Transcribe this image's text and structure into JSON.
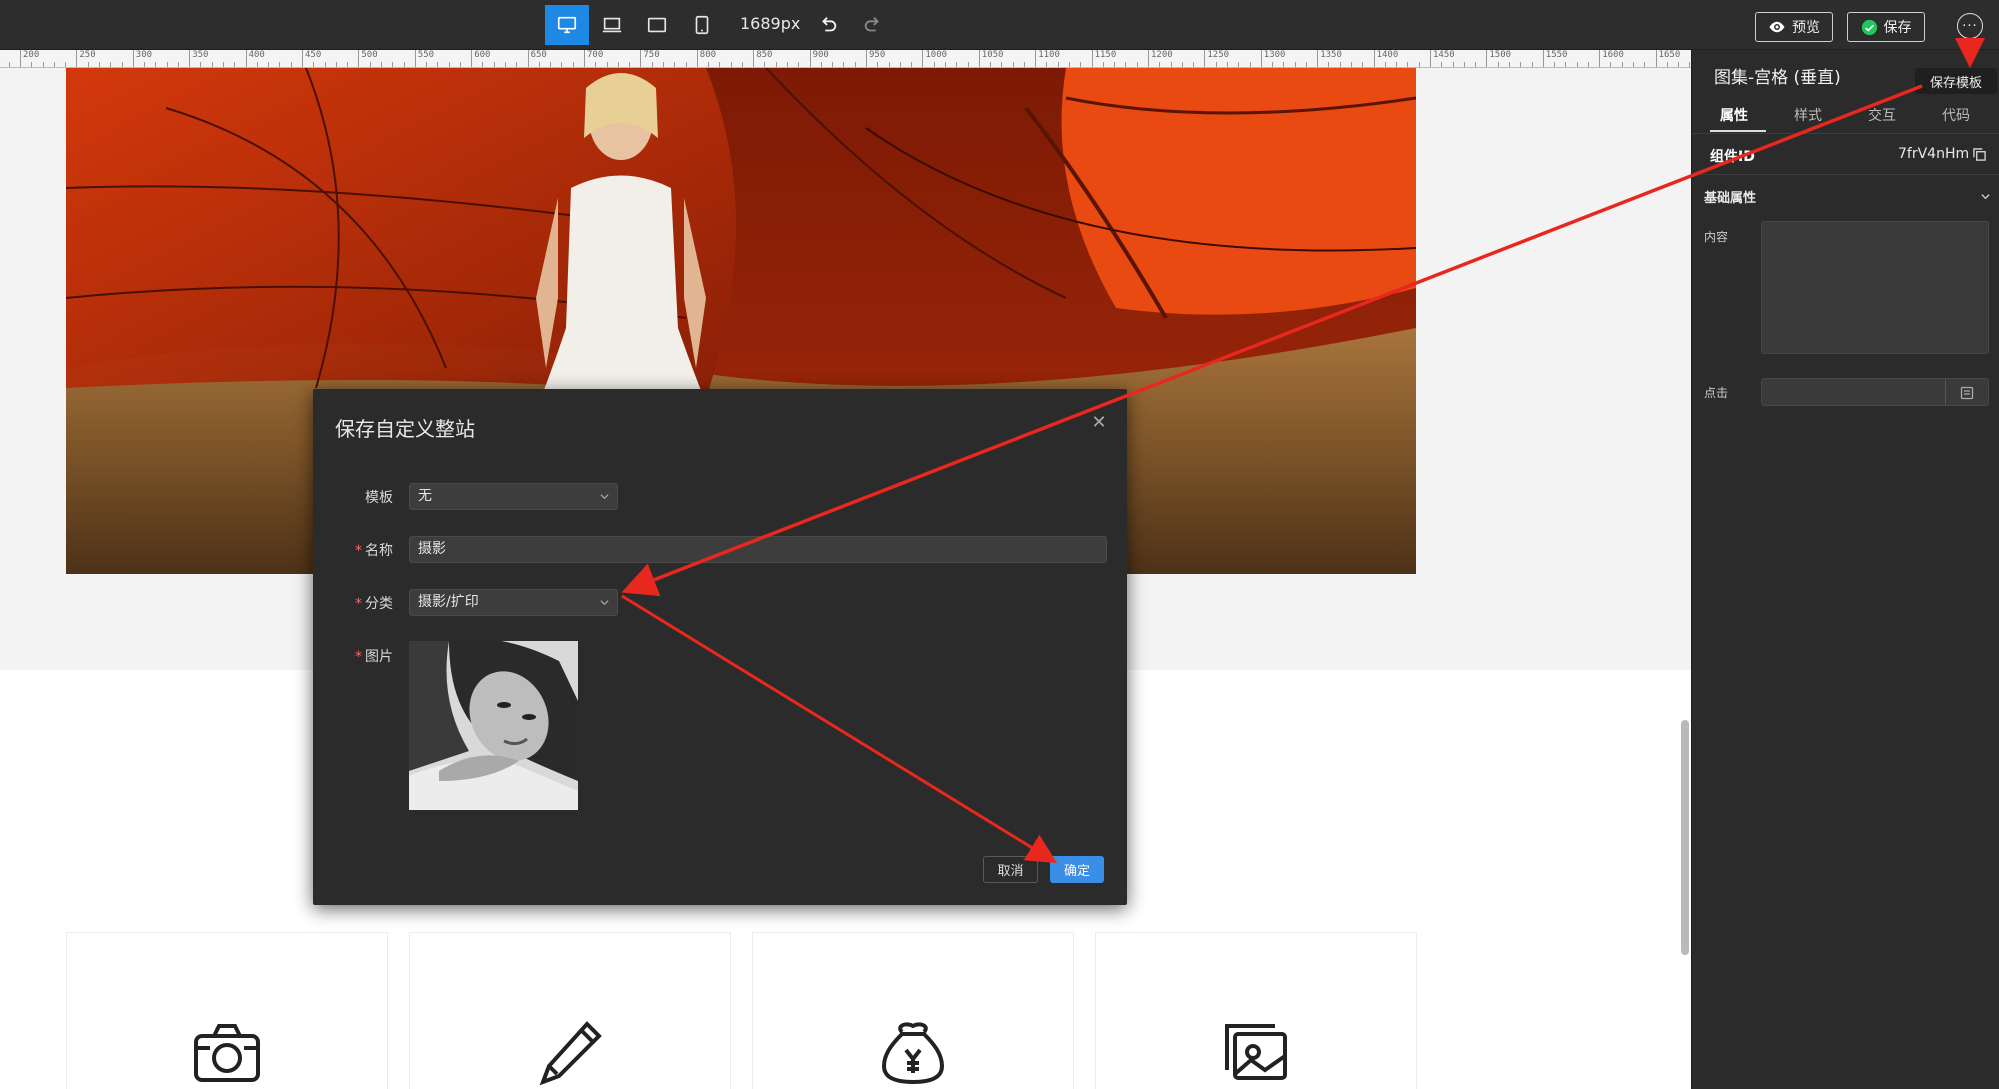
{
  "toolbar": {
    "width_label": "1689px",
    "preview_label": "预览",
    "save_label": "保存",
    "more_label": "···"
  },
  "tooltip": {
    "text": "保存模板"
  },
  "ruler": {
    "start": 200,
    "end": 1650,
    "step": 50
  },
  "dialog": {
    "title": "保存自定义整站",
    "fields": {
      "template_label": "模板",
      "template_value": "无",
      "name_label": "名称",
      "name_value": "摄影",
      "category_label": "分类",
      "category_value": "摄影/扩印",
      "image_label": "图片"
    },
    "cancel_label": "取消",
    "ok_label": "确定",
    "required_mark": "*"
  },
  "panel": {
    "title": "图集-宫格 (垂直)",
    "tabs": [
      {
        "label": "属性"
      },
      {
        "label": "样式"
      },
      {
        "label": "交互"
      },
      {
        "label": "代码"
      }
    ],
    "component_id_label": "组件ID",
    "component_id_value": "7frV4nHm",
    "section_title": "基础属性",
    "content_label": "内容",
    "click_label": "点击"
  },
  "colors": {
    "accent": "#1e88e5",
    "save_icon": "#22c55e",
    "ok_button": "#3a8ee6",
    "annotation": "#e8281e",
    "required": "#f56c6c"
  },
  "icons": {
    "desktop": "desktop-icon",
    "laptop": "laptop-icon",
    "tablet": "tablet-landscape-icon",
    "mobile": "tablet-portrait-icon",
    "undo": "undo-icon",
    "redo": "redo-icon",
    "eye": "eye-icon",
    "check": "check-circle-icon",
    "camera": "camera-icon",
    "pencil": "pencil-icon",
    "money_bag": "money-bag-icon",
    "gallery": "gallery-icon"
  }
}
